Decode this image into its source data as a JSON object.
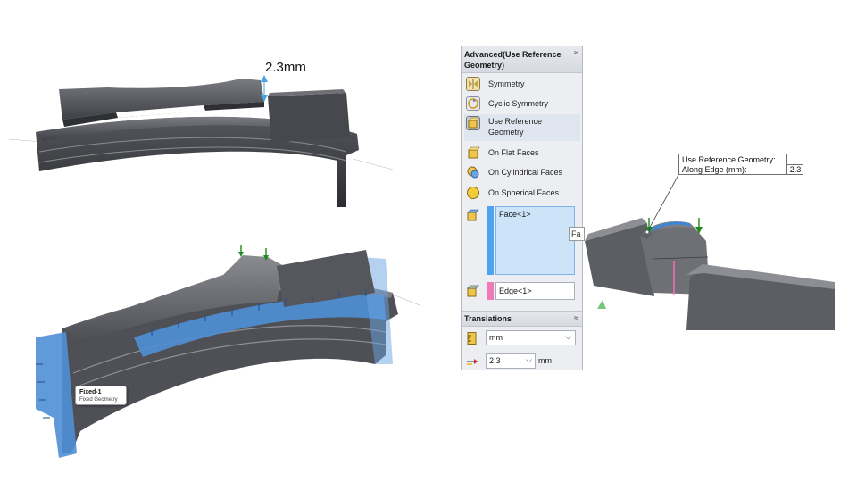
{
  "top_model": {
    "dimension_label": "2.3mm"
  },
  "bottom_model": {
    "fixture_tooltip": {
      "title": "Fixed-1",
      "subtitle": "Fixed Geometry"
    }
  },
  "panel": {
    "advanced_section": {
      "title": "Advanced(Use Reference Geometry)",
      "collapse_glyph": "≈",
      "options": [
        {
          "label": "Symmetry",
          "icon": "symmetry-icon"
        },
        {
          "label": "Cyclic Symmetry",
          "icon": "cyclic-symmetry-icon"
        },
        {
          "label": "Use Reference Geometry",
          "icon": "reference-geometry-icon"
        },
        {
          "label": "On Flat Faces",
          "icon": "flat-faces-icon"
        },
        {
          "label": "On Cylindrical Faces",
          "icon": "cylindrical-faces-icon"
        },
        {
          "label": "On Spherical Faces",
          "icon": "spherical-faces-icon"
        }
      ],
      "face_selection": "Face<1>",
      "edge_selection": "Edge<1>"
    },
    "translations_section": {
      "title": "Translations",
      "collapse_glyph": "≈",
      "unit": "mm",
      "along_edge_value": "2.3",
      "along_edge_unit": "mm"
    }
  },
  "detail_view": {
    "callout": {
      "line1": "Use Reference Geometry:",
      "line2": "Along Edge (mm):",
      "value": "2.3"
    },
    "tooltip_fragment": "Fa"
  },
  "colors": {
    "selection_blue": "#4da3f0",
    "edge_pink": "#f07ab8",
    "arrow_green": "#1f8a1f",
    "model_gray": "#5f6166"
  }
}
